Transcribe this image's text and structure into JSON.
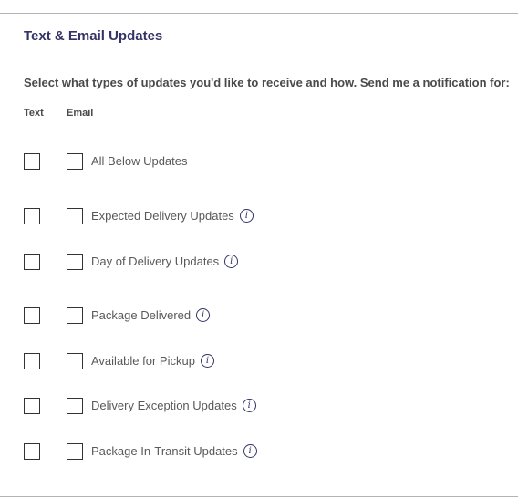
{
  "section": {
    "title": "Text & Email Updates",
    "instructions": "Select what types of updates you'd like to receive and how. Send me a notification for:"
  },
  "columns": {
    "text": "Text",
    "email": "Email"
  },
  "rows": [
    {
      "label": "All Below Updates",
      "info": false,
      "text_checked": false,
      "email_checked": false
    },
    {
      "label": "Expected Delivery Updates",
      "info": true,
      "text_checked": false,
      "email_checked": false
    },
    {
      "label": "Day of Delivery Updates",
      "info": true,
      "text_checked": false,
      "email_checked": false
    },
    {
      "label": "Package Delivered",
      "info": true,
      "text_checked": false,
      "email_checked": false
    },
    {
      "label": "Available for Pickup",
      "info": true,
      "text_checked": false,
      "email_checked": false
    },
    {
      "label": "Delivery Exception Updates",
      "info": true,
      "text_checked": false,
      "email_checked": false
    },
    {
      "label": "Package In-Transit Updates",
      "info": true,
      "text_checked": false,
      "email_checked": false
    }
  ],
  "icons": {
    "info": "info-icon"
  },
  "colors": {
    "title": "#333366",
    "body_text": "#595959",
    "divider": "#b3b3b3"
  }
}
